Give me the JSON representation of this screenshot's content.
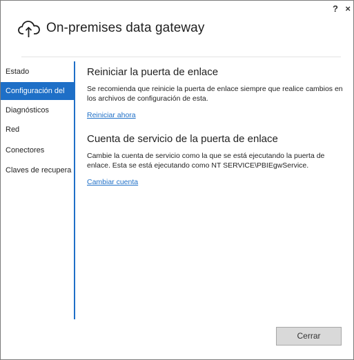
{
  "window": {
    "title": "On-premises data gateway",
    "help_label": "?",
    "close_label": "×"
  },
  "colors": {
    "accent": "#1e6fc7"
  },
  "sidebar": {
    "items": [
      {
        "label": "Estado",
        "active": false
      },
      {
        "label": "Configuración del",
        "active": true
      },
      {
        "label": "Diagnósticos",
        "active": false
      },
      {
        "label": "Red",
        "active": false
      },
      {
        "label": "Conectores",
        "active": false
      },
      {
        "label": "Claves de recupera",
        "active": false
      }
    ]
  },
  "main": {
    "restart": {
      "title": "Reiniciar la puerta de enlace",
      "description": "Se recomienda que reinicie la puerta de enlace siempre que realice cambios en los archivos de configuración de esta.",
      "link": "Reiniciar ahora"
    },
    "service_account": {
      "title": "Cuenta de servicio de la puerta de enlace",
      "description": "Cambie la cuenta de servicio como la que se está ejecutando la puerta de enlace. Esta se está ejecutando como NT SERVICE\\PBIEgwService.",
      "link": "Cambiar cuenta"
    }
  },
  "footer": {
    "close_button": "Cerrar"
  }
}
